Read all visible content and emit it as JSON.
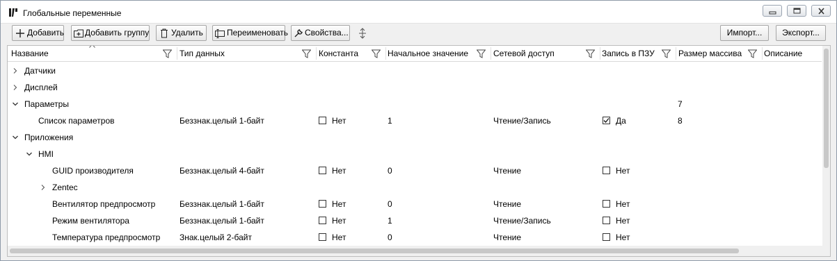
{
  "window": {
    "title": "Глобальные переменные"
  },
  "toolbar": {
    "add_label": "Добавить",
    "add_group_label": "Добавить группу",
    "delete_label": "Удалить",
    "rename_label": "Переименовать",
    "properties_label": "Свойства...",
    "import_label": "Импорт...",
    "export_label": "Экспорт..."
  },
  "columns": {
    "name": "Название",
    "type": "Тип данных",
    "const": "Константа",
    "initial": "Начальное значение",
    "network": "Сетевой доступ",
    "rom": "Запись в ПЗУ",
    "array": "Размер массива",
    "desc": "Описание"
  },
  "rows": [
    {
      "name": "Датчики",
      "expander": "collapsed"
    },
    {
      "name": "Дисплей",
      "expander": "collapsed"
    },
    {
      "name": "Параметры",
      "expander": "expanded",
      "array": "7"
    },
    {
      "name": "Список параметров",
      "type": "Беззнак.целый 1-байт",
      "const": "Нет",
      "const_checked": false,
      "initial": "1",
      "network": "Чтение/Запись",
      "rom": "Да",
      "rom_checked": true,
      "array": "8"
    },
    {
      "name": "Приложения",
      "expander": "expanded"
    },
    {
      "name": "HMI",
      "expander": "expanded"
    },
    {
      "name": "GUID производителя",
      "type": "Беззнак.целый 4-байт",
      "const": "Нет",
      "const_checked": false,
      "initial": "0",
      "network": "Чтение",
      "rom": "Нет",
      "rom_checked": false
    },
    {
      "name": "Zentec",
      "expander": "collapsed"
    },
    {
      "name": "Вентилятор предпросмотр",
      "type": "Беззнак.целый 1-байт",
      "const": "Нет",
      "const_checked": false,
      "initial": "0",
      "network": "Чтение",
      "rom": "Нет",
      "rom_checked": false
    },
    {
      "name": "Режим вентилятора",
      "type": "Беззнак.целый 1-байт",
      "const": "Нет",
      "const_checked": false,
      "initial": "1",
      "network": "Чтение/Запись",
      "rom": "Нет",
      "rom_checked": false
    },
    {
      "name": "Температура предпросмотр",
      "type": "Знак.целый 2-байт",
      "const": "Нет",
      "const_checked": false,
      "initial": "0",
      "network": "Чтение",
      "rom": "Нет",
      "rom_checked": false
    }
  ]
}
